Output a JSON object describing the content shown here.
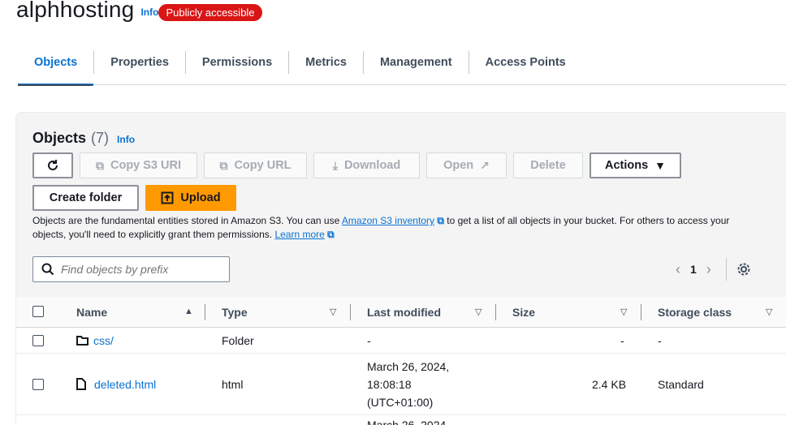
{
  "header": {
    "bucket_name": "alphhosting",
    "info": "Info",
    "badge": "Publicly accessible"
  },
  "tabs": [
    {
      "label": "Objects"
    },
    {
      "label": "Properties"
    },
    {
      "label": "Permissions"
    },
    {
      "label": "Metrics"
    },
    {
      "label": "Management"
    },
    {
      "label": "Access Points"
    }
  ],
  "objects": {
    "title": "Objects",
    "count": "(7)",
    "info": "Info",
    "toolbar": {
      "refresh_icon": "refresh-icon",
      "copy_s3_uri": "Copy S3 URI",
      "copy_url": "Copy URL",
      "download": "Download",
      "open": "Open",
      "delete": "Delete",
      "actions": "Actions",
      "create_folder": "Create folder",
      "upload": "Upload"
    },
    "description": {
      "part1": "Objects are the fundamental entities stored in Amazon S3. You can use ",
      "link1": "Amazon S3 inventory",
      "part2": " to get a list of all objects in your bucket. For others to access your objects, you'll need to explicitly grant them permissions. ",
      "link2": "Learn more"
    },
    "search": {
      "placeholder": "Find objects by prefix"
    },
    "pager": {
      "page": "1"
    }
  },
  "table": {
    "columns": {
      "name": "Name",
      "type": "Type",
      "last_modified": "Last modified",
      "size": "Size",
      "storage_class": "Storage class"
    },
    "rows": [
      {
        "name": "css/",
        "type": "Folder",
        "last_modified": "-",
        "size": "-",
        "storage_class": "-"
      },
      {
        "name": "deleted.html",
        "type": "html",
        "last_modified_1": "March 26, 2024,",
        "last_modified_2": "18:08:18",
        "last_modified_3": "(UTC+01:00)",
        "size": "2.4 KB",
        "storage_class": "Standard"
      },
      {
        "last_modified_1": "March 26, 2024,"
      }
    ]
  },
  "colors": {
    "accent": "#0972d3",
    "badge_red": "#d91515",
    "upload_orange": "#ff9900"
  }
}
